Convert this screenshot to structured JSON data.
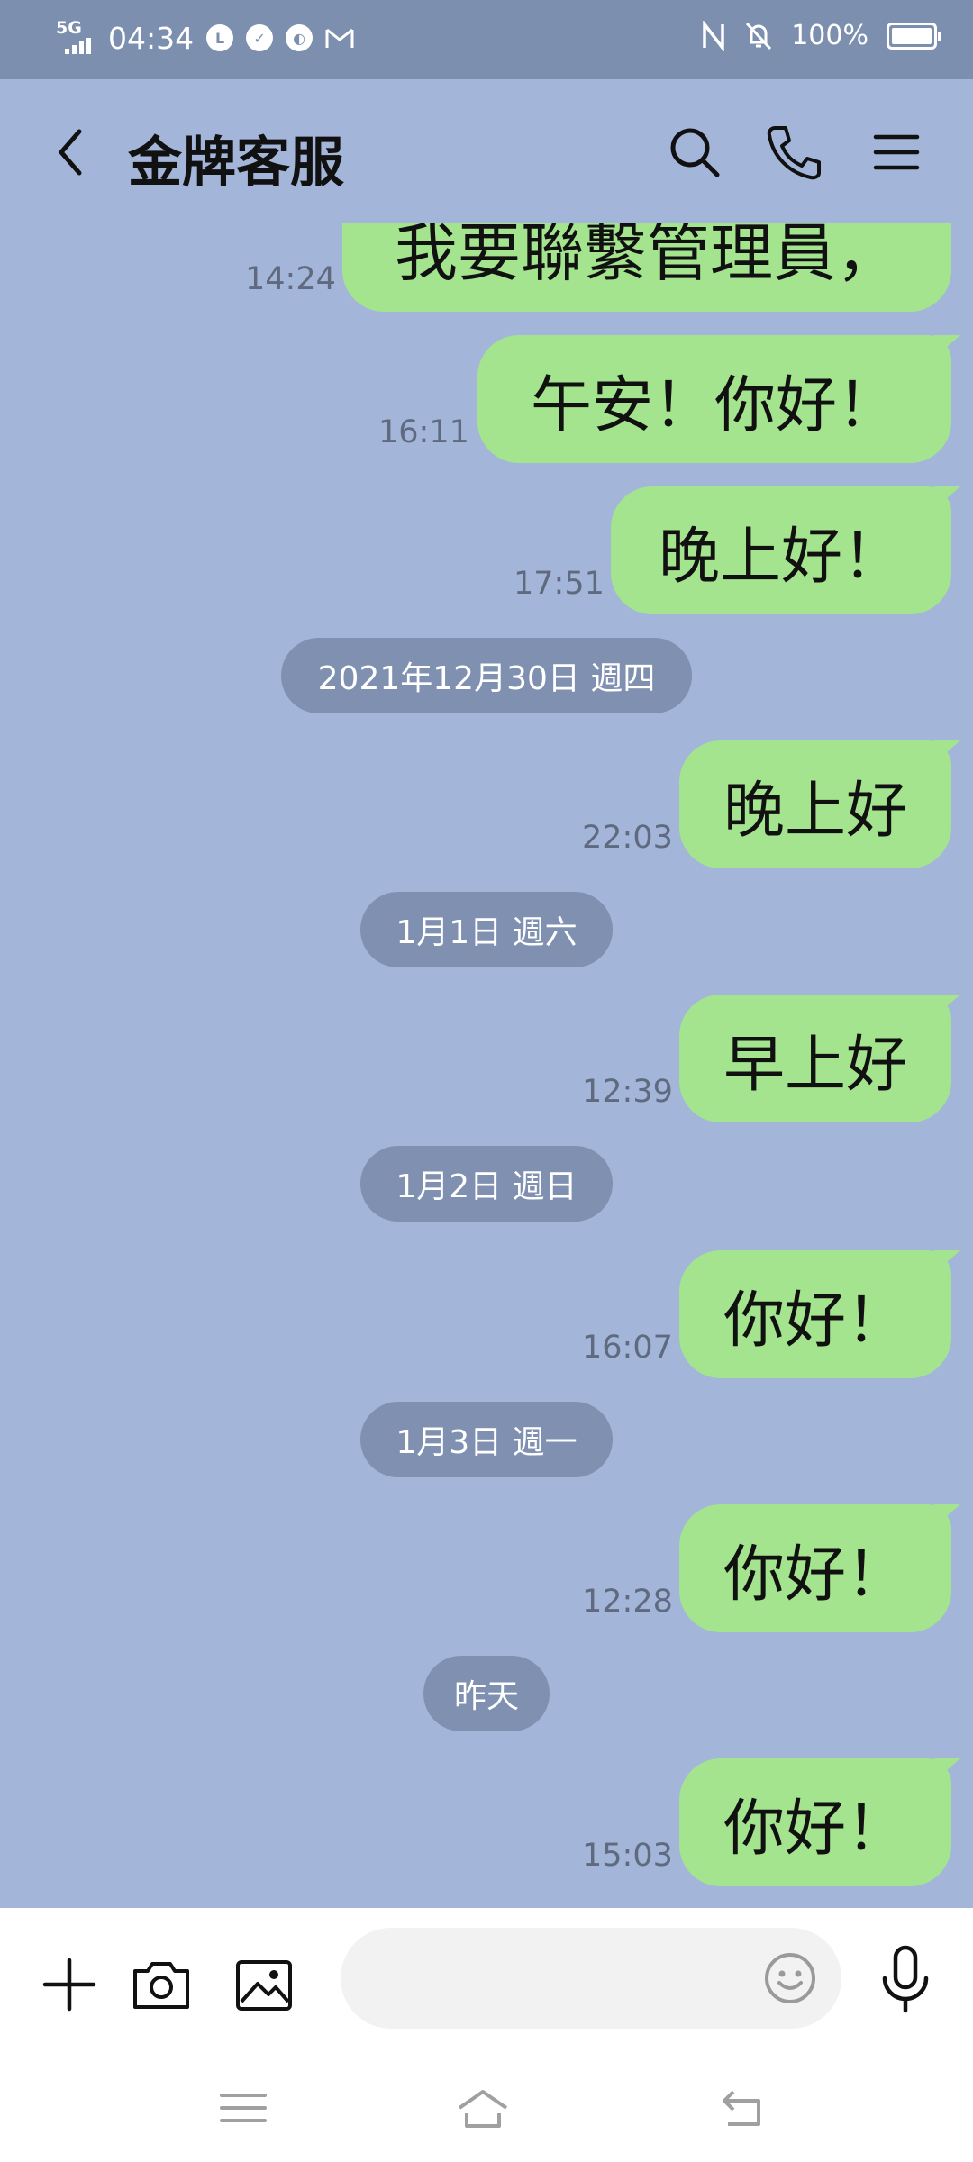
{
  "status_bar": {
    "network": "5G",
    "time": "04:34",
    "notification_icons": [
      "line-icon",
      "check-icon",
      "leaf-icon",
      "gmail-icon"
    ],
    "nfc_icon": "nfc-icon",
    "mute_icon": "bell-off-icon",
    "battery_level": "100%"
  },
  "header": {
    "title": "金牌客服",
    "back_icon": "chevron-left-icon",
    "search_icon": "search-icon",
    "call_icon": "phone-icon",
    "menu_icon": "menu-icon"
  },
  "messages": [
    {
      "text": "我要聯繫管理員，",
      "time": "14:24"
    },
    {
      "text": "午安！你好！",
      "time": "16:11"
    },
    {
      "text": "晚上好！",
      "time": "17:51"
    },
    {
      "date": "2021年12月30日 週四"
    },
    {
      "text": "晚上好",
      "time": "22:03"
    },
    {
      "date": "1月1日 週六"
    },
    {
      "text": "早上好",
      "time": "12:39"
    },
    {
      "date": "1月2日 週日"
    },
    {
      "text": "你好！",
      "time": "16:07"
    },
    {
      "date": "1月3日 週一"
    },
    {
      "text": "你好！",
      "time": "12:28"
    },
    {
      "date": "昨天"
    },
    {
      "text": "你好！",
      "time": "15:03"
    }
  ],
  "input_bar": {
    "plus_icon": "plus-icon",
    "camera_icon": "camera-icon",
    "image_icon": "image-icon",
    "placeholder": "",
    "emoji_icon": "smiley-icon",
    "mic_icon": "microphone-icon"
  },
  "system_nav": {
    "recents_icon": "recents-icon",
    "home_icon": "home-icon",
    "back_icon": "back-icon"
  },
  "colors": {
    "chat_background": "#a4b5da",
    "status_bar": "#7d8faf",
    "bubble_green": "#a4e48e",
    "date_pill": "#7f90b1"
  }
}
